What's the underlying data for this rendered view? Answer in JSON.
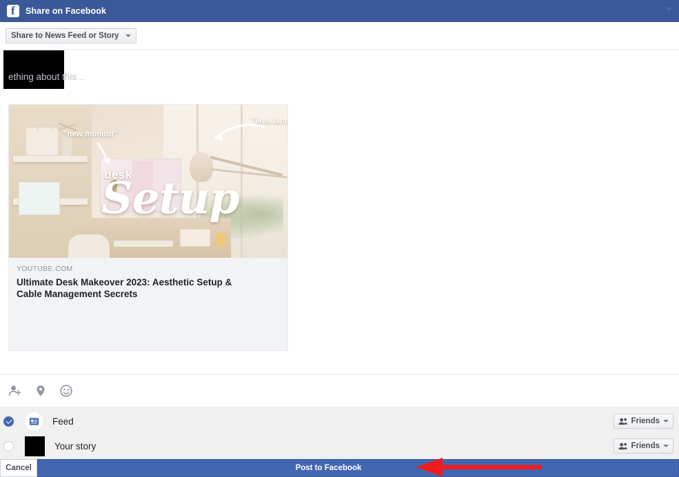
{
  "window": {
    "title": "Share on Facebook",
    "logo_icon": "facebook-f-logo",
    "collapse_icon": "chevron-down-icon"
  },
  "share_target": {
    "label": "Share to News Feed or Story",
    "caret_icon": "caret-down-icon"
  },
  "composer": {
    "avatar": "redacted-avatar-black-block",
    "placeholder": "Say something about this...",
    "visible_placeholder_fragment": "ething about this..."
  },
  "link_preview": {
    "domain": "YOUTUBE.COM",
    "title": "Ultimate Desk Makeover 2023: Aesthetic Setup & Cable Management Secrets",
    "thumbnail": {
      "alt": "Aesthetic home desk setup with monitor, lamp and window",
      "overlay_labels": [
        "\"new monitor\"",
        "\"ikea lamp\""
      ],
      "overlay_word_top": "desk",
      "overlay_word_script": "Setup"
    }
  },
  "attachment_toolbar": {
    "items": [
      {
        "name": "tag-people-icon",
        "label": "Tag people"
      },
      {
        "name": "location-pin-icon",
        "label": "Check in"
      },
      {
        "name": "feeling-emoji-icon",
        "label": "Feeling/Activity"
      }
    ]
  },
  "destinations": [
    {
      "id": "feed",
      "label": "Feed",
      "selected": true,
      "icon": "news-feed-icon",
      "audience": {
        "label": "Friends",
        "icon": "friends-icon",
        "caret": "caret-down-icon"
      }
    },
    {
      "id": "your-story",
      "label": "Your story",
      "selected": false,
      "icon": "story-thumbnail-redacted",
      "audience": {
        "label": "Friends",
        "icon": "friends-icon",
        "caret": "caret-down-icon"
      }
    }
  ],
  "footer": {
    "cancel_label": "Cancel",
    "post_label": "Post to Facebook"
  },
  "annotation": {
    "type": "arrow",
    "color": "#ee1c1c",
    "points_to": "post-to-facebook-button",
    "direction": "left"
  },
  "colors": {
    "header_blue": "#3b5998",
    "primary_blue": "#4267b2",
    "gray_panel": "#f0f0f0",
    "card_gray": "#f2f3f5",
    "text_dark": "#1d2129",
    "text_muted": "#90949c",
    "annotation_red": "#ee1c1c"
  }
}
